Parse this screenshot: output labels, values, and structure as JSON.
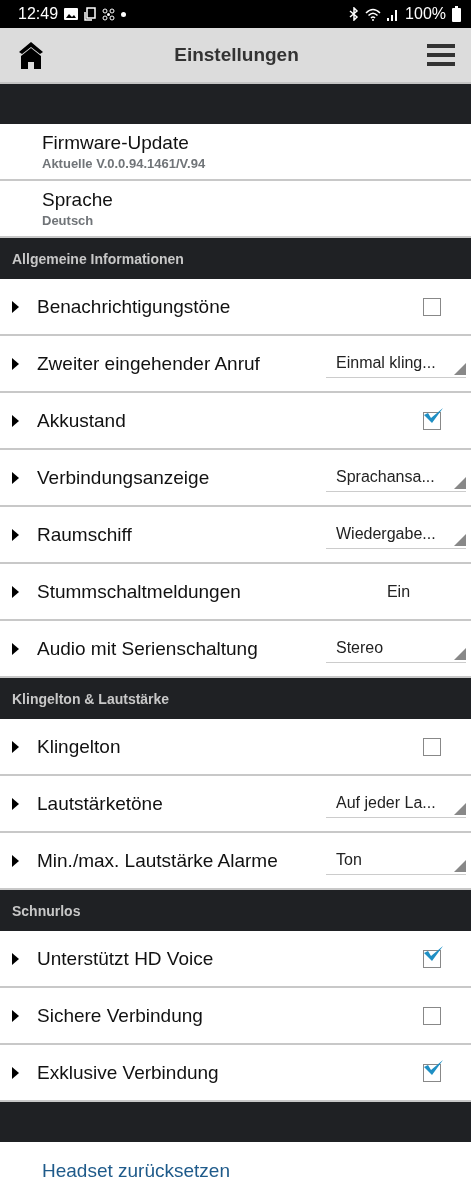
{
  "status_bar": {
    "time": "12:49",
    "battery": "100%"
  },
  "header": {
    "title": "Einstellungen"
  },
  "info_rows": [
    {
      "label": "Firmware-Update",
      "value": "Aktuelle V.0.0.94.1461/V.94"
    },
    {
      "label": "Sprache",
      "value": "Deutsch"
    }
  ],
  "sections": [
    {
      "title": "Allgemeine Informationen",
      "rows": [
        {
          "kind": "checkbox",
          "label": "Benachrichtigungstöne",
          "checked": false
        },
        {
          "kind": "dropdown",
          "label": "Zweiter eingehender Anruf",
          "value": "Einmal kling..."
        },
        {
          "kind": "checkbox",
          "label": "Akkustand",
          "checked": true
        },
        {
          "kind": "dropdown",
          "label": "Verbindungsanzeige",
          "value": "Sprachansa..."
        },
        {
          "kind": "dropdown",
          "label": "Raumschiff",
          "value": "Wiedergabe..."
        },
        {
          "kind": "value",
          "label": "Stummschaltmeldungen",
          "value": "Ein"
        },
        {
          "kind": "dropdown",
          "label": "Audio mit Serienschaltung",
          "value": "Stereo"
        }
      ]
    },
    {
      "title": "Klingelton & Lautstärke",
      "rows": [
        {
          "kind": "checkbox",
          "label": "Klingelton",
          "checked": false
        },
        {
          "kind": "dropdown",
          "label": "Lautstärketöne",
          "value": "Auf jeder La..."
        },
        {
          "kind": "dropdown",
          "label": "Min./max. Lautstärke Alarme",
          "value": "Ton"
        }
      ]
    },
    {
      "title": "Schnurlos",
      "rows": [
        {
          "kind": "checkbox",
          "label": "Unterstützt HD Voice",
          "checked": true
        },
        {
          "kind": "checkbox",
          "label": "Sichere Verbindung",
          "checked": false
        },
        {
          "kind": "checkbox",
          "label": "Exklusive Verbindung",
          "checked": true
        }
      ]
    }
  ],
  "reset_link": "Headset zurücksetzen"
}
